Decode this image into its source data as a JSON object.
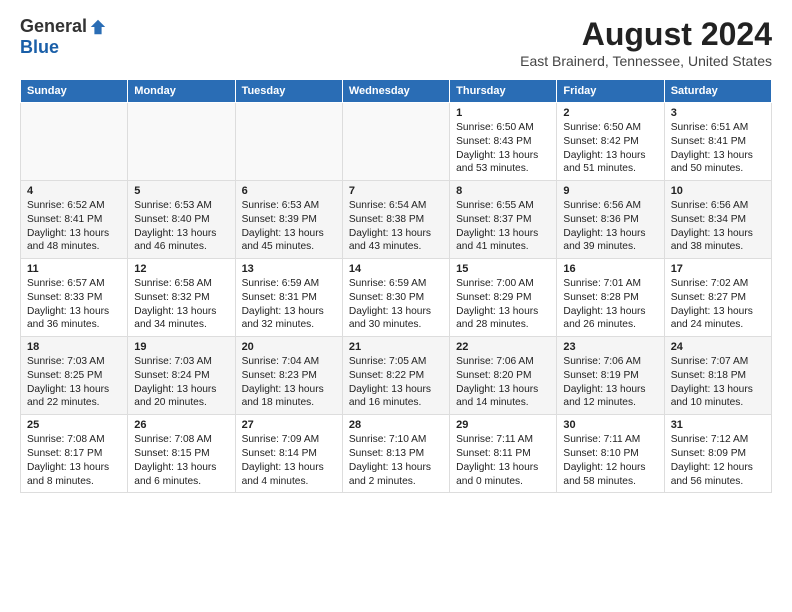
{
  "header": {
    "logo_general": "General",
    "logo_blue": "Blue",
    "title": "August 2024",
    "subtitle": "East Brainerd, Tennessee, United States"
  },
  "calendar": {
    "days_of_week": [
      "Sunday",
      "Monday",
      "Tuesday",
      "Wednesday",
      "Thursday",
      "Friday",
      "Saturday"
    ],
    "weeks": [
      [
        {
          "day": "",
          "content": ""
        },
        {
          "day": "",
          "content": ""
        },
        {
          "day": "",
          "content": ""
        },
        {
          "day": "",
          "content": ""
        },
        {
          "day": "1",
          "content": "Sunrise: 6:50 AM\nSunset: 8:43 PM\nDaylight: 13 hours\nand 53 minutes."
        },
        {
          "day": "2",
          "content": "Sunrise: 6:50 AM\nSunset: 8:42 PM\nDaylight: 13 hours\nand 51 minutes."
        },
        {
          "day": "3",
          "content": "Sunrise: 6:51 AM\nSunset: 8:41 PM\nDaylight: 13 hours\nand 50 minutes."
        }
      ],
      [
        {
          "day": "4",
          "content": "Sunrise: 6:52 AM\nSunset: 8:41 PM\nDaylight: 13 hours\nand 48 minutes."
        },
        {
          "day": "5",
          "content": "Sunrise: 6:53 AM\nSunset: 8:40 PM\nDaylight: 13 hours\nand 46 minutes."
        },
        {
          "day": "6",
          "content": "Sunrise: 6:53 AM\nSunset: 8:39 PM\nDaylight: 13 hours\nand 45 minutes."
        },
        {
          "day": "7",
          "content": "Sunrise: 6:54 AM\nSunset: 8:38 PM\nDaylight: 13 hours\nand 43 minutes."
        },
        {
          "day": "8",
          "content": "Sunrise: 6:55 AM\nSunset: 8:37 PM\nDaylight: 13 hours\nand 41 minutes."
        },
        {
          "day": "9",
          "content": "Sunrise: 6:56 AM\nSunset: 8:36 PM\nDaylight: 13 hours\nand 39 minutes."
        },
        {
          "day": "10",
          "content": "Sunrise: 6:56 AM\nSunset: 8:34 PM\nDaylight: 13 hours\nand 38 minutes."
        }
      ],
      [
        {
          "day": "11",
          "content": "Sunrise: 6:57 AM\nSunset: 8:33 PM\nDaylight: 13 hours\nand 36 minutes."
        },
        {
          "day": "12",
          "content": "Sunrise: 6:58 AM\nSunset: 8:32 PM\nDaylight: 13 hours\nand 34 minutes."
        },
        {
          "day": "13",
          "content": "Sunrise: 6:59 AM\nSunset: 8:31 PM\nDaylight: 13 hours\nand 32 minutes."
        },
        {
          "day": "14",
          "content": "Sunrise: 6:59 AM\nSunset: 8:30 PM\nDaylight: 13 hours\nand 30 minutes."
        },
        {
          "day": "15",
          "content": "Sunrise: 7:00 AM\nSunset: 8:29 PM\nDaylight: 13 hours\nand 28 minutes."
        },
        {
          "day": "16",
          "content": "Sunrise: 7:01 AM\nSunset: 8:28 PM\nDaylight: 13 hours\nand 26 minutes."
        },
        {
          "day": "17",
          "content": "Sunrise: 7:02 AM\nSunset: 8:27 PM\nDaylight: 13 hours\nand 24 minutes."
        }
      ],
      [
        {
          "day": "18",
          "content": "Sunrise: 7:03 AM\nSunset: 8:25 PM\nDaylight: 13 hours\nand 22 minutes."
        },
        {
          "day": "19",
          "content": "Sunrise: 7:03 AM\nSunset: 8:24 PM\nDaylight: 13 hours\nand 20 minutes."
        },
        {
          "day": "20",
          "content": "Sunrise: 7:04 AM\nSunset: 8:23 PM\nDaylight: 13 hours\nand 18 minutes."
        },
        {
          "day": "21",
          "content": "Sunrise: 7:05 AM\nSunset: 8:22 PM\nDaylight: 13 hours\nand 16 minutes."
        },
        {
          "day": "22",
          "content": "Sunrise: 7:06 AM\nSunset: 8:20 PM\nDaylight: 13 hours\nand 14 minutes."
        },
        {
          "day": "23",
          "content": "Sunrise: 7:06 AM\nSunset: 8:19 PM\nDaylight: 13 hours\nand 12 minutes."
        },
        {
          "day": "24",
          "content": "Sunrise: 7:07 AM\nSunset: 8:18 PM\nDaylight: 13 hours\nand 10 minutes."
        }
      ],
      [
        {
          "day": "25",
          "content": "Sunrise: 7:08 AM\nSunset: 8:17 PM\nDaylight: 13 hours\nand 8 minutes."
        },
        {
          "day": "26",
          "content": "Sunrise: 7:08 AM\nSunset: 8:15 PM\nDaylight: 13 hours\nand 6 minutes."
        },
        {
          "day": "27",
          "content": "Sunrise: 7:09 AM\nSunset: 8:14 PM\nDaylight: 13 hours\nand 4 minutes."
        },
        {
          "day": "28",
          "content": "Sunrise: 7:10 AM\nSunset: 8:13 PM\nDaylight: 13 hours\nand 2 minutes."
        },
        {
          "day": "29",
          "content": "Sunrise: 7:11 AM\nSunset: 8:11 PM\nDaylight: 13 hours\nand 0 minutes."
        },
        {
          "day": "30",
          "content": "Sunrise: 7:11 AM\nSunset: 8:10 PM\nDaylight: 12 hours\nand 58 minutes."
        },
        {
          "day": "31",
          "content": "Sunrise: 7:12 AM\nSunset: 8:09 PM\nDaylight: 12 hours\nand 56 minutes."
        }
      ]
    ]
  }
}
